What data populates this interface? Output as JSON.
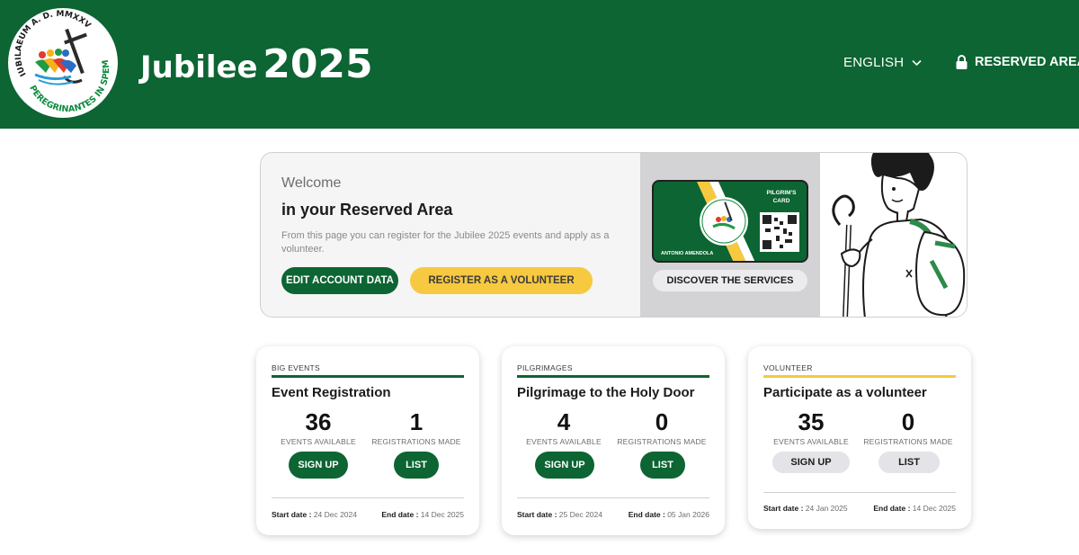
{
  "header": {
    "logo_ring_text_top": "IUBILAEUM A. D. MMXXV",
    "logo_ring_text_bottom": "PEREGRINANTES IN SPEM",
    "title_word": "Jubilee",
    "title_year": "2025",
    "language": "ENGLISH",
    "reserved_area": "RESERVED AREA"
  },
  "welcome": {
    "greeting": "Welcome",
    "title": "in your Reserved Area",
    "description": "From this page you can register for the Jubilee 2025 events and apply as a volunteer.",
    "edit_button": "EDIT ACCOUNT DATA",
    "volunteer_button": "REGISTER AS A VOLUNTEER"
  },
  "pilgrim_card": {
    "label": "PILGRIM'S CARD",
    "holder_name": "ANTONIO AMENDOLA",
    "discover_button": "DISCOVER THE SERVICES"
  },
  "cards": [
    {
      "category": "BIG EVENTS",
      "title": "Event Registration",
      "events_available": "36",
      "events_available_label": "EVENTS AVAILABLE",
      "registrations_made": "1",
      "registrations_made_label": "REGISTRATIONS MADE",
      "signup_button": "SIGN UP",
      "list_button": "LIST",
      "start_label": "Start date :",
      "start_date": "24 Dec 2024",
      "end_label": "End date :",
      "end_date": "14 Dec 2025"
    },
    {
      "category": "PILGRIMAGES",
      "title": "Pilgrimage to the Holy Door",
      "events_available": "4",
      "events_available_label": "EVENTS AVAILABLE",
      "registrations_made": "0",
      "registrations_made_label": "REGISTRATIONS MADE",
      "signup_button": "SIGN UP",
      "list_button": "LIST",
      "start_label": "Start date :",
      "start_date": "25 Dec 2024",
      "end_label": "End date :",
      "end_date": "05 Jan 2026"
    },
    {
      "category": "VOLUNTEER",
      "title": "Participate as a volunteer",
      "events_available": "35",
      "events_available_label": "EVENTS AVAILABLE",
      "registrations_made": "0",
      "registrations_made_label": "REGISTRATIONS MADE",
      "signup_button": "SIGN UP",
      "list_button": "LIST",
      "start_label": "Start date :",
      "start_date": "24 Jan 2025",
      "end_label": "End date :",
      "end_date": "14 Dec 2025"
    }
  ],
  "colors": {
    "brand_green": "#0c6532",
    "accent_yellow": "#f7c940",
    "disabled_grey": "#e4e4e8"
  },
  "icons": {
    "language_chevron": "chevron-down-icon",
    "reserved_lock": "lock-icon"
  }
}
